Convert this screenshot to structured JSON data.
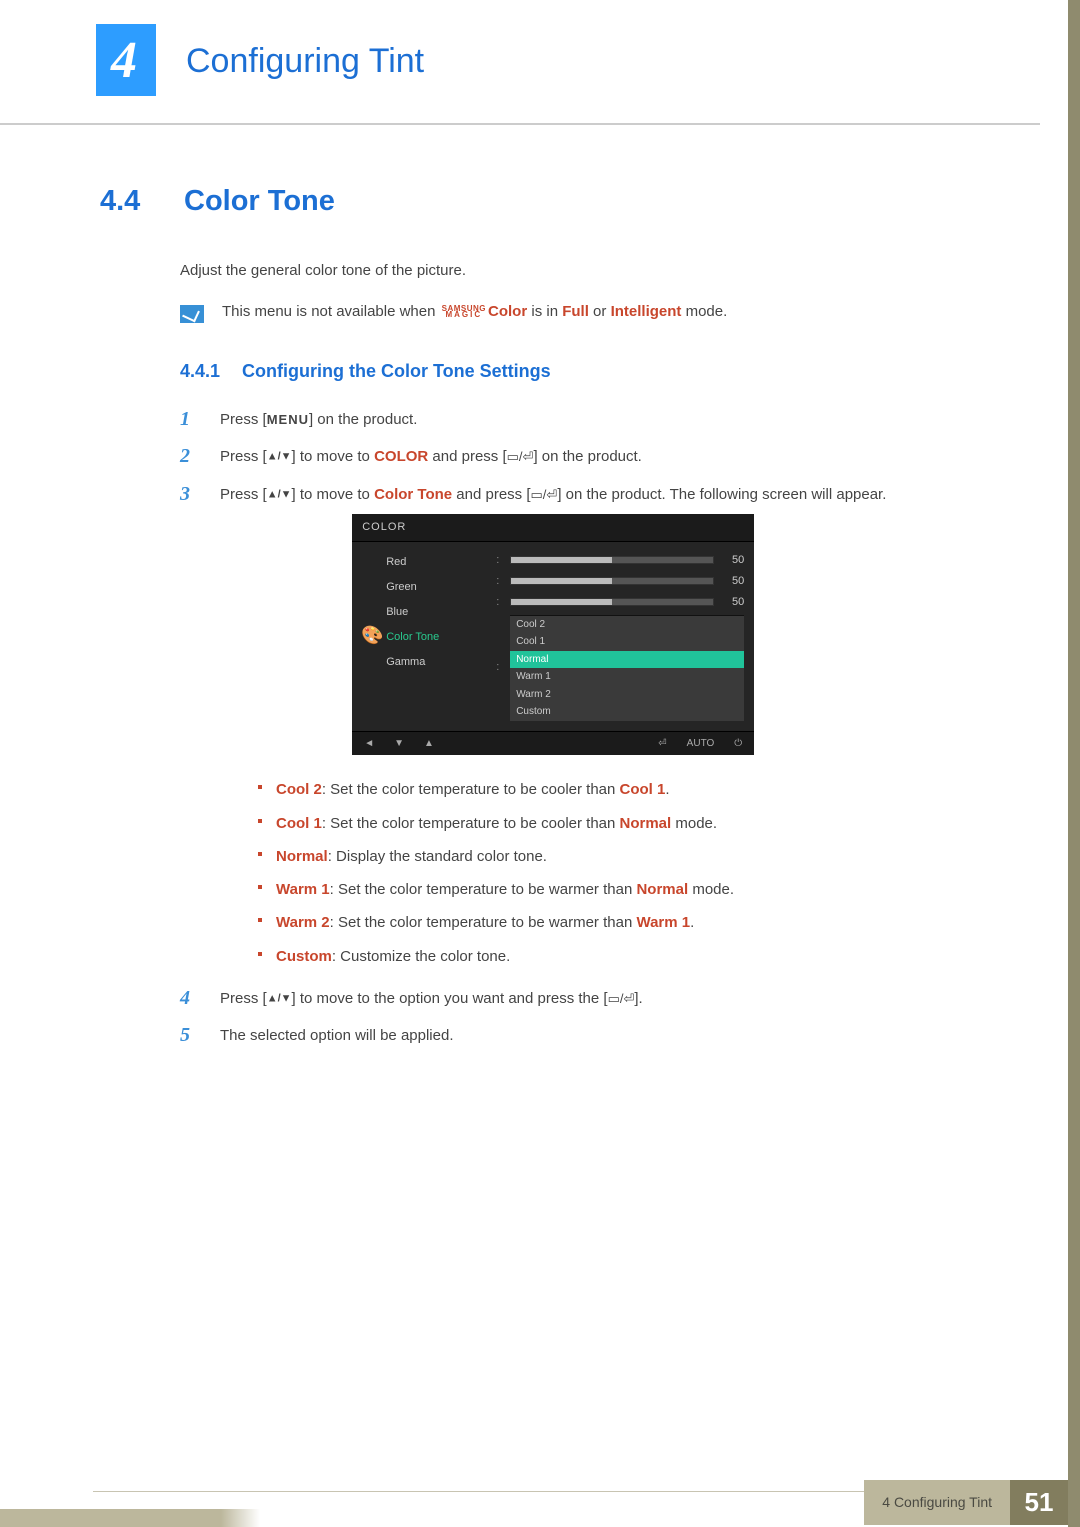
{
  "chapter": {
    "number": "4",
    "title": "Configuring Tint"
  },
  "section": {
    "number": "4.4",
    "title": "Color Tone"
  },
  "intro": "Adjust the general color tone of the picture.",
  "note": {
    "pre": "This menu is not available when ",
    "magic_top": "SAMSUNG",
    "magic_bot": "MAGIC",
    "color_word": "Color",
    "mid": " is in ",
    "full": "Full",
    "or": " or ",
    "intelligent": "Intelligent",
    "post": " mode."
  },
  "subsection": {
    "number": "4.4.1",
    "title": "Configuring the Color Tone Settings"
  },
  "steps": {
    "s1": {
      "num": "1",
      "a": "Press [",
      "menu": "MENU",
      "b": "] on the product."
    },
    "s2": {
      "num": "2",
      "a": "Press [",
      "arrows": "▲/▼",
      "b": "] to move to ",
      "color": "COLOR",
      "c": " and press [",
      "btn": "▭/⏎",
      "d": "] on the product."
    },
    "s3": {
      "num": "3",
      "a": "Press [",
      "arrows": "▲/▼",
      "b": "] to move to ",
      "ct": "Color Tone",
      "c": " and press [",
      "btn": "▭/⏎",
      "d": "] on the product. The following screen will appear."
    },
    "s4": {
      "num": "4",
      "a": "Press [",
      "arrows": "▲/▼",
      "b": "] to move to the option you want and press the [",
      "btn": "▭/⏎",
      "c": "]."
    },
    "s5": {
      "num": "5",
      "text": "The selected option will be applied."
    }
  },
  "osd": {
    "title": "COLOR",
    "labels": {
      "red": "Red",
      "green": "Green",
      "blue": "Blue",
      "color_tone": "Color Tone",
      "gamma": "Gamma"
    },
    "values": {
      "red": "50",
      "green": "50",
      "blue": "50"
    },
    "options": {
      "cool2": "Cool 2",
      "cool1": "Cool 1",
      "normal": "Normal",
      "warm1": "Warm 1",
      "warm2": "Warm 2",
      "custom": "Custom"
    },
    "bottom": {
      "left": "◄",
      "down": "▼",
      "up": "▲",
      "enter": "⏎",
      "auto": "AUTO",
      "power": "⏻"
    }
  },
  "bullets": {
    "b1": {
      "label": "Cool 2",
      "text": ": Set the color temperature to be cooler than ",
      "ref": "Cool 1",
      "tail": "."
    },
    "b2": {
      "label": "Cool 1",
      "text": ": Set the color temperature to be cooler than ",
      "ref": "Normal",
      "tail": " mode."
    },
    "b3": {
      "label": "Normal",
      "text": ": Display the standard color tone."
    },
    "b4": {
      "label": "Warm 1",
      "text": ": Set the color temperature to be warmer than ",
      "ref": "Normal",
      "tail": " mode."
    },
    "b5": {
      "label": "Warm 2",
      "text": ": Set the color temperature to be warmer than ",
      "ref": "Warm 1",
      "tail": "."
    },
    "b6": {
      "label": "Custom",
      "text": ": Customize the color tone."
    }
  },
  "footer": {
    "label": "4 Configuring Tint",
    "page": "51"
  }
}
